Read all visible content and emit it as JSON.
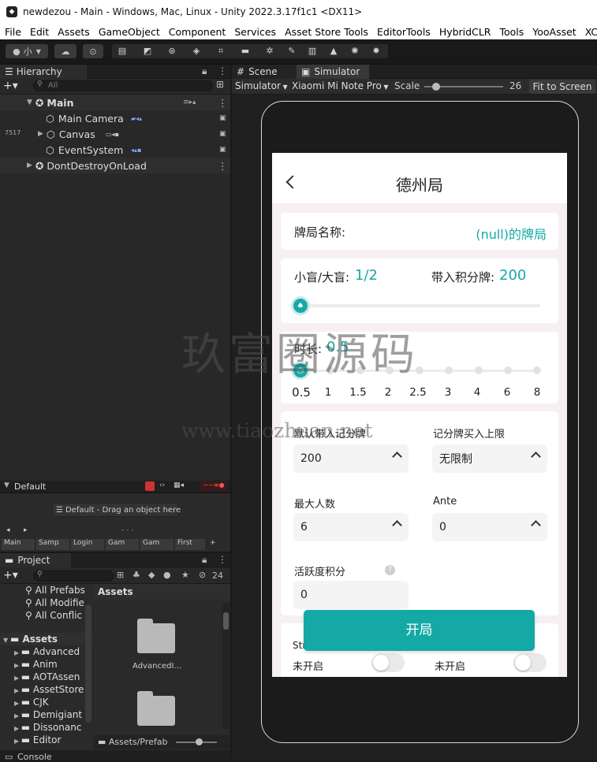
{
  "window": {
    "title": "newdezou - Main - Windows, Mac, Linux - Unity 2022.3.17f1c1 <DX11>"
  },
  "menu": [
    "File",
    "Edit",
    "Assets",
    "GameObject",
    "Component",
    "Services",
    "Asset Store Tools",
    "EditorTools",
    "HybridCLR",
    "Tools",
    "YooAsset",
    "XC"
  ],
  "toolbar": {
    "account_label": "小"
  },
  "hierarchy": {
    "tab": "Hierarchy",
    "search_placeholder": "All",
    "side_number": "7517",
    "items": [
      "Main",
      "Main Camera",
      "Canvas",
      "EventSystem",
      "DontDestroyOnLoad"
    ]
  },
  "default_panel": {
    "tab": "Default",
    "drop_hint": "Default - Drag an object here",
    "dashes": "- - -",
    "tabs": [
      "Main",
      "Samp",
      "Login",
      "Gam",
      "Gam",
      "First"
    ]
  },
  "project": {
    "tab": "Project",
    "count": "24",
    "favorites": [
      "All Prefabs",
      "All Modifie",
      "All Conflic"
    ],
    "assets_root": "Assets",
    "tree": [
      "Advanced",
      "Anim",
      "AOTAssen",
      "AssetStore",
      "CJK",
      "Demigiant",
      "Dissonanc",
      "Editor"
    ],
    "grid_title": "Assets",
    "grid_items": [
      "AdvancedI..."
    ],
    "path": "Assets/Prefab"
  },
  "console": {
    "tab": "Console"
  },
  "scene_tab": "Scene",
  "simulator": {
    "tab": "Simulator",
    "mode": "Simulator",
    "device": "Xiaomi Mi Note Pro",
    "scale_label": "Scale",
    "scale_value": "26",
    "scale_fraction": 0.15,
    "fit_label": "Fit to Screen"
  },
  "game": {
    "title": "德州局",
    "room_name_label": "牌局名称:",
    "room_name_value": "(null)的牌局",
    "blinds_label": "小盲/大盲:",
    "blinds_value": "1/2",
    "buyin_label": "带入积分牌:",
    "buyin_value": "200",
    "duration_label": "时长:",
    "duration_value": "0.5",
    "duration_ticks": [
      "0.5",
      "1",
      "1.5",
      "2",
      "2.5",
      "3",
      "4",
      "6",
      "8"
    ],
    "default_buyin_label": "默认带入记分牌",
    "default_buyin_value": "200",
    "buyin_limit_label": "记分牌买入上限",
    "buyin_limit_value": "无限制",
    "max_players_label": "最大人数",
    "max_players_value": "6",
    "ante_label": "Ante",
    "ante_value": "0",
    "activity_label": "活跃度积分",
    "activity_value": "0",
    "start_button": "开局",
    "toggle_left_title": "Str",
    "toggle_left_state": "未开启",
    "toggle_right_state": "未开启"
  },
  "watermark": {
    "line1": "玖富圈源码",
    "line2": "www.tiaozhuan.net"
  },
  "colors": {
    "accent": "#15a9a6",
    "editor_bg": "#282828"
  }
}
